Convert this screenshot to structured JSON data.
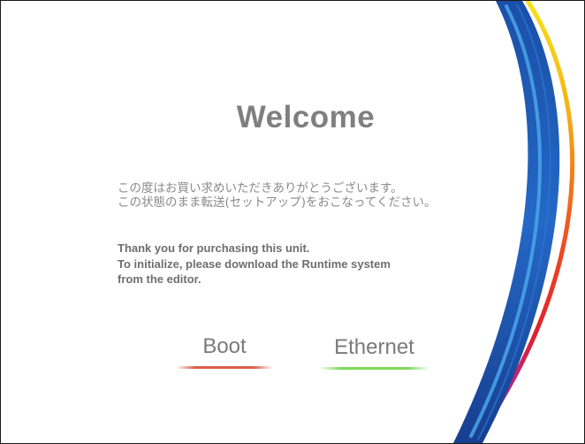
{
  "welcome": {
    "title": "Welcome",
    "message_jp": [
      "この度はお買い求めいただきありがとうございます。",
      "この状態のまま転送(セットアップ)をおこなってください。"
    ],
    "message_en": [
      "Thank you for purchasing this unit.",
      "To initialize, please download the Runtime system",
      "from the editor."
    ]
  },
  "buttons": {
    "boot": {
      "label": "Boot",
      "accent_color": "#d9604a"
    },
    "ethernet": {
      "label": "Ethernet",
      "accent_color": "#7ed957"
    }
  },
  "colors": {
    "swoosh_blue": "#1f5cb8",
    "swoosh_light_blue": "#3ea3e8",
    "swoosh_yellow": "#f5d100",
    "swoosh_orange": "#f08a1c",
    "swoosh_red": "#e8202a",
    "swoosh_purple": "#8a2fc8"
  }
}
